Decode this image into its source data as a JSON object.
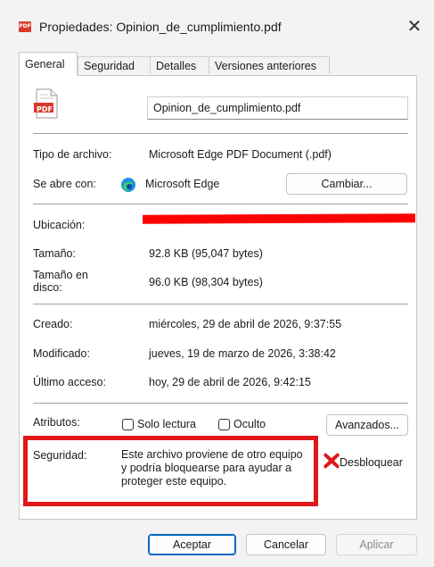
{
  "window": {
    "title": "Propiedades: Opinion_de_cumplimiento.pdf",
    "icon_text": "PDF",
    "close_glyph": "✕"
  },
  "tabs": [
    {
      "label": "General",
      "active": true
    },
    {
      "label": "Seguridad",
      "active": false
    },
    {
      "label": "Detalles",
      "active": false
    },
    {
      "label": "Versiones anteriores",
      "active": false
    }
  ],
  "file": {
    "icon_text": "PDF",
    "name": "Opinion_de_cumplimiento.pdf"
  },
  "type": {
    "label": "Tipo de archivo:",
    "value": "Microsoft Edge PDF Document (.pdf)"
  },
  "opens_with": {
    "label": "Se abre con:",
    "value": "Microsoft Edge",
    "button": "Cambiar..."
  },
  "location": {
    "label": "Ubicación:"
  },
  "size": {
    "label": "Tamaño:",
    "value": "92.8 KB (95,047 bytes)"
  },
  "size_on_disk": {
    "label_line1": "Tamaño en",
    "label_line2": "disco:",
    "value": "96.0 KB (98,304 bytes)"
  },
  "created": {
    "label": "Creado:",
    "value": "miércoles, 29 de abril de 2026, 9:37:55"
  },
  "modified": {
    "label": "Modificado:",
    "value": "jueves, 19 de marzo de 2026, 3:38:42"
  },
  "accessed": {
    "label": "Último acceso:",
    "value": "hoy, 29 de abril de 2026, 9:42:15"
  },
  "attributes": {
    "label": "Atributos:",
    "readonly": "Solo lectura",
    "hidden": "Oculto",
    "advanced": "Avanzados..."
  },
  "security": {
    "label": "Seguridad:",
    "line1": "Este archivo proviene de otro equipo",
    "line2": "y podría bloquearse para ayudar a",
    "line3": "proteger este equipo.",
    "unblock": "Desbloquear"
  },
  "footer": {
    "ok": "Aceptar",
    "cancel": "Cancelar",
    "apply": "Aplicar"
  },
  "colors": {
    "accent": "#0067c0",
    "annotation_red": "#e0181b",
    "pdf_red": "#d83b2b"
  }
}
